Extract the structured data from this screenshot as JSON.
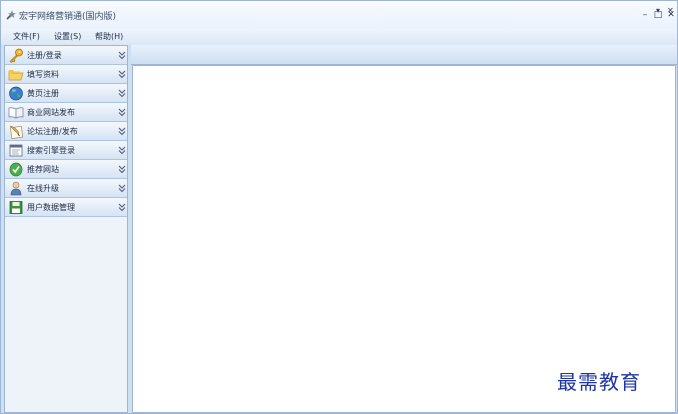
{
  "window": {
    "title": "宏宇网络营销通(国内版)",
    "icon": "wrench-star-icon",
    "controls": {
      "minimize": "–",
      "maximize": "□",
      "close": "✕"
    }
  },
  "menubar": {
    "items": [
      {
        "label": "文件(F)"
      },
      {
        "label": "设置(S)"
      },
      {
        "label": "帮助(H)"
      }
    ]
  },
  "sidebar": {
    "items": [
      {
        "label": "注册/登录",
        "icon": "key-icon"
      },
      {
        "label": "填写资料",
        "icon": "folder-icon"
      },
      {
        "label": "黄页注册",
        "icon": "globe-icon"
      },
      {
        "label": "商业网站发布",
        "icon": "book-icon"
      },
      {
        "label": "论坛注册/发布",
        "icon": "quill-paper-icon"
      },
      {
        "label": "搜索引擎登录",
        "icon": "search-page-icon"
      },
      {
        "label": "推荐网站",
        "icon": "check-badge-icon"
      },
      {
        "label": "在线升级",
        "icon": "user-update-icon"
      },
      {
        "label": "用户数据管理",
        "icon": "floppy-disk-icon"
      }
    ]
  },
  "tabstrip": {
    "dropdown": "▾",
    "close": "✕"
  },
  "watermark": {
    "text": "最需教育"
  }
}
